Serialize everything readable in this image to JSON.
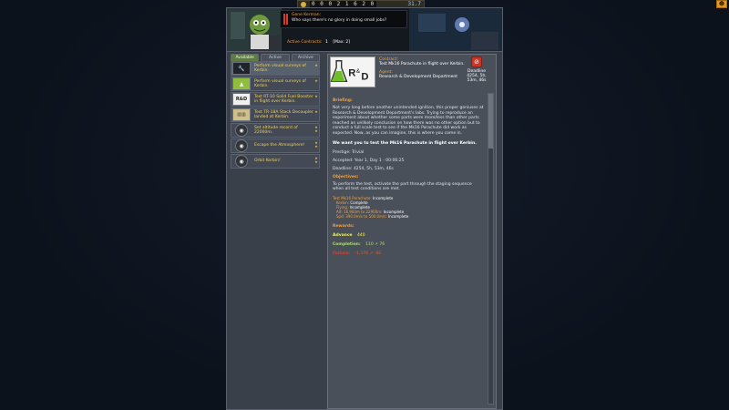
{
  "topbar": {
    "funds": "0 0 0 2 1 6 2 0",
    "science": "31.7",
    "corner_icon": "kerbal-head-icon"
  },
  "header": {
    "speaker": "Gene Kerman:",
    "quote": "Who says there's no glory in doing small jobs?",
    "active_label": "Active Contracts:",
    "active_value": "1",
    "active_max": "[Max: 2]"
  },
  "tabs": [
    {
      "label": "Available",
      "active": true
    },
    {
      "label": "Active",
      "active": false
    },
    {
      "label": "Archive",
      "active": false
    }
  ],
  "contracts": [
    {
      "title": "Perform visual surveys of Kerbin.",
      "icon": "wrench-icon",
      "selected": true
    },
    {
      "title": "Perform visual surveys of Kerbin.",
      "icon": "flame-icon",
      "selected": false
    },
    {
      "title": "Test RT-10 Solid Fuel Booster in flight over Kerbin.",
      "icon": "rnd-icon",
      "selected": false
    },
    {
      "title": "Test TR-18A Stack Decoupler landed at Kerbin.",
      "icon": "stack-icon",
      "selected": false
    },
    {
      "title": "Set altitude record of 22000m.",
      "icon": "altitude-icon",
      "selected": false
    },
    {
      "title": "Escape the Atmosphere!",
      "icon": "rocket-icon",
      "selected": false
    },
    {
      "title": "Orbit Kerbin!",
      "icon": "orbit-icon",
      "selected": false
    }
  ],
  "detail": {
    "contract_label": "Contract:",
    "contract_value": "Test Mk16 Parachute in flight over Kerbin.",
    "agent_label": "Agent:",
    "agent_value": "Research & Development Department",
    "deadline_label": "Deadline",
    "deadline_value": "4254, 5h, 53m, 46s",
    "briefing_h": "Briefing:",
    "briefing": "Not very long before another unintended ignition, this proper geniuses at Research & Development Department's labs. Trying to reproduce an experiment about whether some parts were more/less than other parts reached an unlikely conclusion on how there was no other option but to conduct a full scale test to see if the Mk16 Parachute did work as expected. Now, as you can imagine, this is where you come in.",
    "lead": "We want you to test the Mk16 Parachute in flight over Kerbin.",
    "prestige_label": "Prestige:",
    "prestige": "Trivial",
    "accepted_label": "Accepted:",
    "accepted": "Year 1, Day 1 - 00:06:25",
    "deadline2_label": "Deadline:",
    "deadline2": "4254, 5h, 53m, 46s",
    "objectives_h": "Objectives:",
    "objectives": "To perform the test, activate the part through the staging sequence when all test conditions are met.",
    "params": [
      {
        "label": "Test Mk16 Parachute:",
        "status": "Incomplete"
      },
      {
        "label": "Kerbin:",
        "status": "Complete"
      },
      {
        "label": "Flying:",
        "status": "Incomplete"
      },
      {
        "label": "Alt: 16,983m to 22900m:",
        "status": "Incomplete"
      },
      {
        "label": "Spd: 390.0m/s to 500.0m/s:",
        "status": "Incomplete"
      }
    ],
    "rewards_h": "Rewards:",
    "advance_label": "Advance",
    "advance": "440",
    "completion_label": "Completion:",
    "completion": "110   ↗ 76",
    "failure_label": "Failure:",
    "failure": "-1,376   ↗ -88"
  },
  "colors": {
    "accent": "#f0a040",
    "title": "#f2d05a",
    "good": "#a8e06a",
    "bad": "#e03a2a"
  }
}
